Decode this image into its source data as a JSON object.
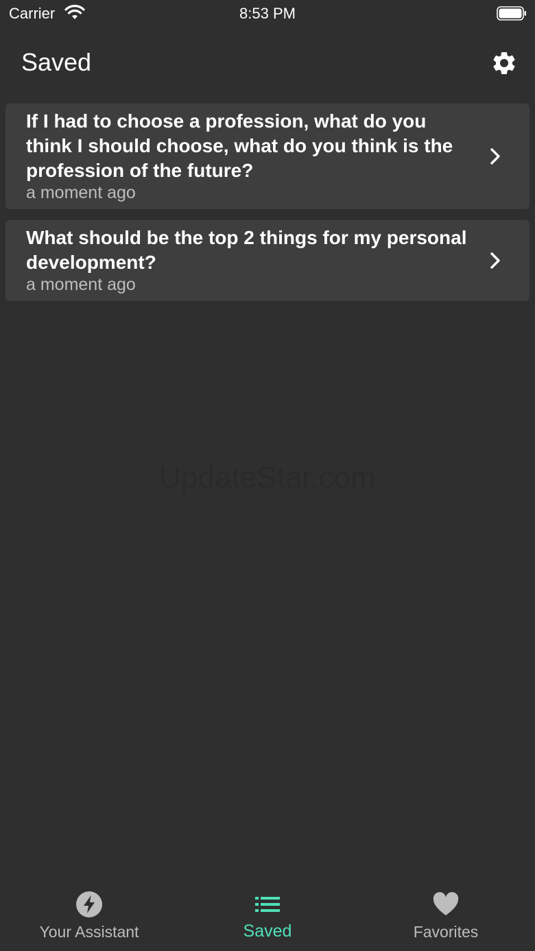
{
  "status_bar": {
    "carrier": "Carrier",
    "time": "8:53 PM"
  },
  "header": {
    "title": "Saved",
    "settings_icon": "gear-icon"
  },
  "saved_items": [
    {
      "title": "If I had to choose a profession, what do you think I should choose, what do you think is the profession of the future?",
      "time": "a moment ago"
    },
    {
      "title": "What should be the top 2 things for my personal development?",
      "time": "a moment ago"
    }
  ],
  "watermark": "UpdateStar.com",
  "tabs": [
    {
      "label": "Your Assistant",
      "icon": "bolt-icon",
      "active": false
    },
    {
      "label": "Saved",
      "icon": "list-icon",
      "active": true
    },
    {
      "label": "Favorites",
      "icon": "heart-icon",
      "active": false
    }
  ],
  "colors": {
    "background": "#2f2f2f",
    "card": "#3e3e3e",
    "accent": "#4fe0b7",
    "secondary_text": "#bdbdbd"
  }
}
